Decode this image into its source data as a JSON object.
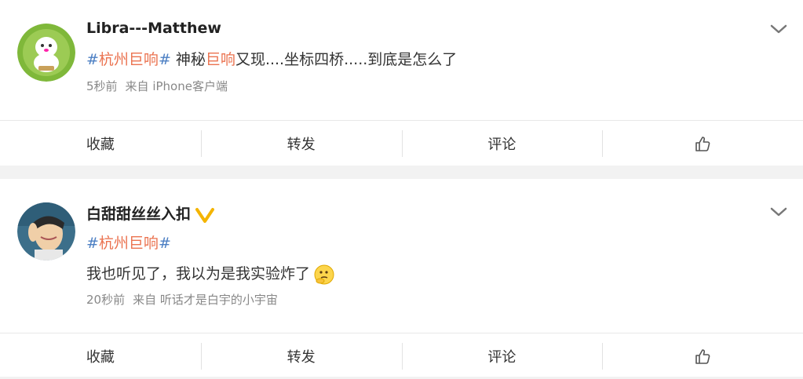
{
  "posts": [
    {
      "username": "Libra---Matthew",
      "content": {
        "topic_hash_open": "#",
        "topic_text": "杭州巨响",
        "topic_hash_close": "#",
        "text_a": "神秘",
        "highlight": "巨响",
        "text_b": "又现....坐标四桥.....到底是怎么了"
      },
      "time": "5秒前",
      "source": "来自 iPhone客户端",
      "verified": false
    },
    {
      "username": "白甜甜丝丝入扣",
      "content": {
        "topic_hash_open": "#",
        "topic_text": "杭州巨响",
        "topic_hash_close": "#",
        "line2": "我也听见了，我以为是我实验炸了"
      },
      "time": "20秒前",
      "source": "来自 听话才是白宇的小宇宙",
      "verified": true
    }
  ],
  "actions": {
    "favorite": "收藏",
    "repost": "转发",
    "comment": "评论"
  },
  "colors": {
    "topic": "#eb7350",
    "hash": "#4c7fc3",
    "verified_badge": "#f4b400",
    "background": "#f2f2f2"
  },
  "icons": {
    "more": "chevron-down-icon",
    "like": "thumbs-up-icon",
    "verified": "verified-v-icon",
    "emoji": "thinking-face-icon"
  }
}
